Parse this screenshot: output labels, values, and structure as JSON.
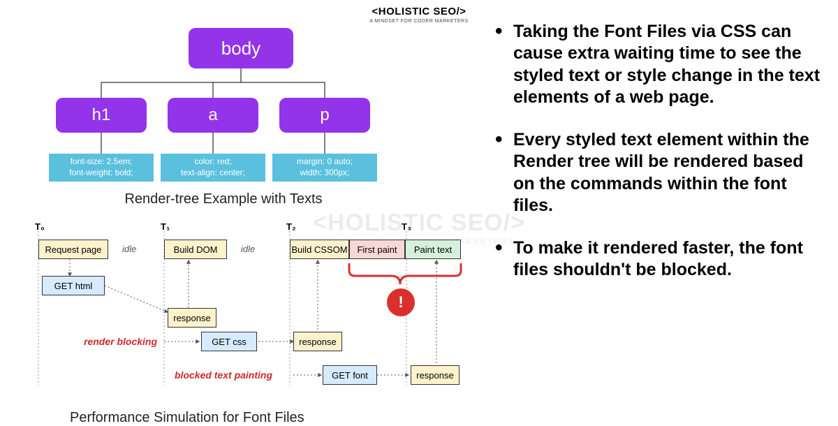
{
  "logo": {
    "main": "<HOLISTIC SEO/>",
    "sub": "A MINDSET FOR CODER MARKETERS"
  },
  "tree": {
    "body": "body",
    "h1": "h1",
    "a": "a",
    "p": "p",
    "h1_css_l1": "font-size: 2.5em;",
    "h1_css_l2": "font-weight: bold;",
    "a_css_l1": "color: red;",
    "a_css_l2": "text-align: center;",
    "p_css_l1": "margin: 0 auto;",
    "p_css_l2": "width: 300px;",
    "caption": "Render-tree Example with Texts"
  },
  "timeline": {
    "t0": "T₀",
    "t1": "T₁",
    "t2": "T₂",
    "t3": "T₃",
    "request_page": "Request page",
    "build_dom": "Build DOM",
    "build_cssom": "Build CSSOM",
    "first_paint": "First paint",
    "paint_text": "Paint text",
    "get_html": "GET html",
    "get_css": "GET css",
    "get_font": "GET font",
    "response": "response",
    "idle": "idle",
    "render_blocking": "render blocking",
    "blocked_text_painting": "blocked text painting",
    "alert": "!",
    "caption": "Performance Simulation for Font Files"
  },
  "bullets": [
    "Taking the Font Files via CSS can cause extra waiting time to see the styled text or style change in the text elements of a web page.",
    "Every styled text element within the Render tree will be rendered based on the commands within the font files.",
    "To make it rendered faster, the font files shouldn't be blocked."
  ],
  "watermark": {
    "main": "<HOLISTIC SEO/>",
    "sub": "A MINDSET FOR CODER MARKETERS"
  }
}
